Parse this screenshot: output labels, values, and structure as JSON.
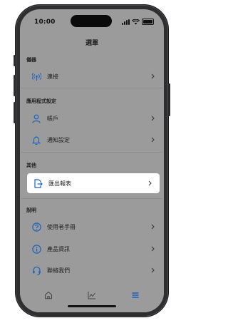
{
  "status_bar": {
    "time": "10:00"
  },
  "header": {
    "title": "選單"
  },
  "sections": {
    "device": {
      "label": "儀器"
    },
    "app_settings": {
      "label": "應用程式設定"
    },
    "other": {
      "label": "其他"
    },
    "help": {
      "label": "說明"
    }
  },
  "items": {
    "connection": {
      "label": "連接",
      "icon": "antenna-icon"
    },
    "account": {
      "label": "帳戶",
      "icon": "person-icon"
    },
    "notifications": {
      "label": "通知設定",
      "icon": "bell-icon"
    },
    "export": {
      "label": "匯出報表",
      "icon": "export-icon",
      "selected": true
    },
    "manual": {
      "label": "使用者手冊",
      "icon": "question-icon"
    },
    "product_info": {
      "label": "產品資訊",
      "icon": "info-icon"
    },
    "contact": {
      "label": "聯絡我們",
      "icon": "headset-icon"
    }
  },
  "tabbar": {
    "tabs": [
      {
        "icon": "home-icon"
      },
      {
        "icon": "chart-icon"
      },
      {
        "icon": "menu-icon",
        "active": true
      }
    ]
  },
  "colors": {
    "accent": "#1a63c4",
    "overlay": "#9b9b9b",
    "selected_row": "#ffffff"
  }
}
